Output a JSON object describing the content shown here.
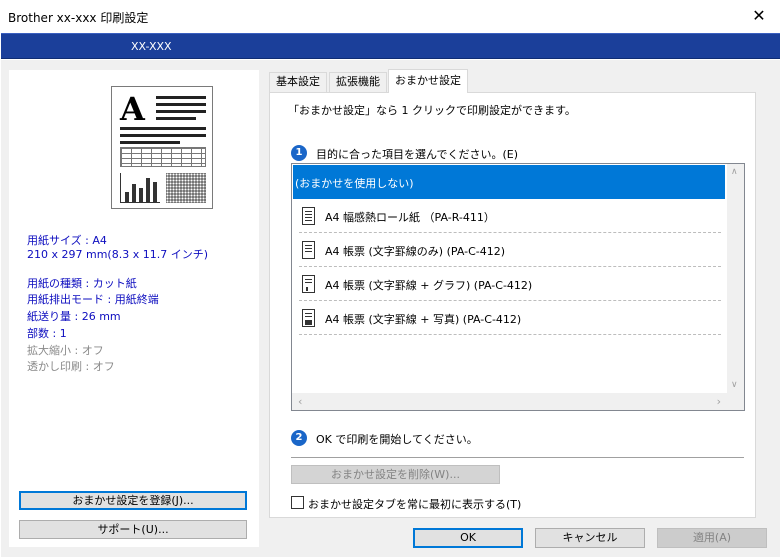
{
  "window": {
    "title": "Brother xx-xxx  印刷設定",
    "close_glyph": "✕",
    "model": "XX-XXX"
  },
  "left": {
    "paper_size": "用紙サイズ : A4",
    "paper_dims": "210 x 297 mm(8.3 x 11.7 インチ)",
    "media_type": "用紙の種類 : カット紙",
    "feed_mode": "用紙排出モード : 用紙終端",
    "feed_amount": "紙送り量 : 26 mm",
    "copies": "部数 : 1",
    "scaling": "拡大縮小 : オフ",
    "watermark": "透かし印刷 : オフ",
    "register_button": "おまかせ設定を登録(J)...",
    "support_button": "サポート(U)..."
  },
  "tabs": [
    {
      "label": "基本設定"
    },
    {
      "label": "拡張機能"
    },
    {
      "label": "おまかせ設定"
    }
  ],
  "panel": {
    "description": "「おまかせ設定」なら 1 クリックで印刷設定ができます。",
    "step1_number": "1",
    "step1_label": "目的に合った項目を選んでください。(E)",
    "items": [
      {
        "label": "(おまかせを使用しない)"
      },
      {
        "label": "A4 幅感熱ロール紙 （PA-R-411）"
      },
      {
        "label": "A4 帳票 (文字罫線のみ) (PA-C-412)"
      },
      {
        "label": "A4 帳票 (文字罫線 + グラフ) (PA-C-412)"
      },
      {
        "label": "A4 帳票 (文字罫線 + 写真) (PA-C-412)"
      }
    ],
    "step2_number": "2",
    "step2_label": "OK で印刷を開始してください。",
    "delete_button": "おまかせ設定を削除(W)...",
    "always_show_label": "おまかせ設定タブを常に最初に表示する(T)"
  },
  "buttons": {
    "ok": "OK",
    "cancel": "キャンセル",
    "apply": "適用(A)"
  }
}
